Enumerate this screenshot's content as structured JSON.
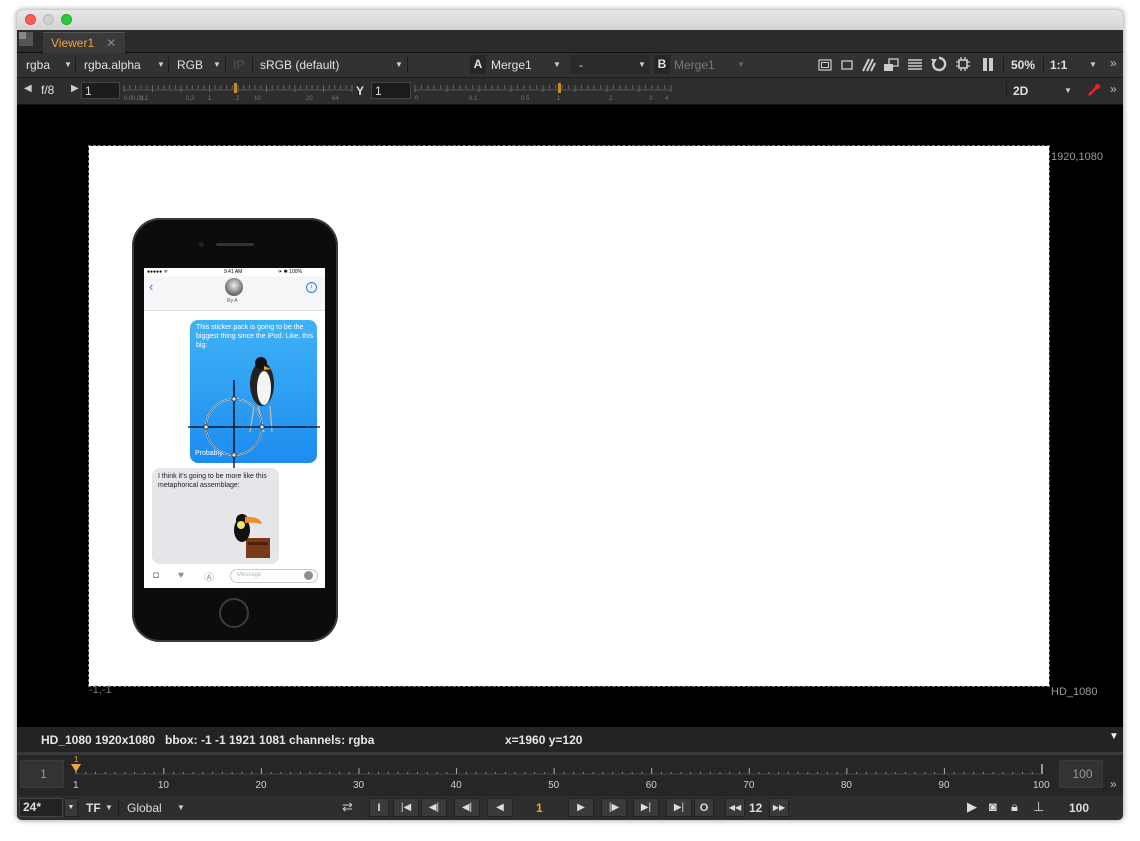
{
  "window": {
    "tab_title": "Viewer1",
    "tab_close": "✕"
  },
  "toolbar1": {
    "channels": "rgba",
    "alpha_channel": "rgba.alpha",
    "display_channel": "RGB",
    "ip_label": "IP",
    "colorspace": "sRGB (default)",
    "input_a_label": "A",
    "input_a": "Merge1",
    "operation": "-",
    "input_b_label": "B",
    "input_b": "Merge1",
    "zoom": "50%",
    "ratio": "1:1"
  },
  "toolbar2": {
    "fstop": "f/8",
    "gain": "1",
    "gain_ticks": [
      "0.0",
      "0.01",
      "0.1",
      "0.2",
      "1",
      "2",
      "10",
      "20",
      "64"
    ],
    "gamma_label": "Y",
    "gamma": "1",
    "gamma_ticks": [
      "0",
      "0.1",
      "0.5",
      "1",
      "2",
      "3",
      "4"
    ],
    "view_mode": "2D"
  },
  "viewer": {
    "top_right_label": "1920,1080",
    "bottom_left_label": "-1,-1",
    "bottom_right_label": "HD_1080"
  },
  "phone": {
    "status_time": "9:41 AM",
    "status_signal": "●●●●● ᯤ",
    "status_battery": "✈ ✱ 100%",
    "contact_name": "Ry A",
    "message1": "This sticker pack is going to be the biggest thing since the iPod. Like, this big:",
    "message1_tail": "Probably.",
    "message2": "I think it's going to be more like this metaphorical assemblage:",
    "input_placeholder": "Message"
  },
  "info_bar": {
    "format": "HD_1080 1920x1080",
    "bbox": "bbox: -1 -1 1921 1081 channels: rgba",
    "coords": "x=1960 y=120"
  },
  "timeline": {
    "start_frame": "1",
    "end_frame": "100",
    "current_marker": "1",
    "ticks": [
      "1",
      "10",
      "20",
      "30",
      "40",
      "50",
      "60",
      "70",
      "80",
      "90",
      "100"
    ],
    "current_frame": "1"
  },
  "transport": {
    "fps": "24*",
    "tf": "TF",
    "mode": "Global",
    "frame": "1",
    "step": "12",
    "in_point": "I",
    "out_point": "O",
    "end_value": "100"
  }
}
